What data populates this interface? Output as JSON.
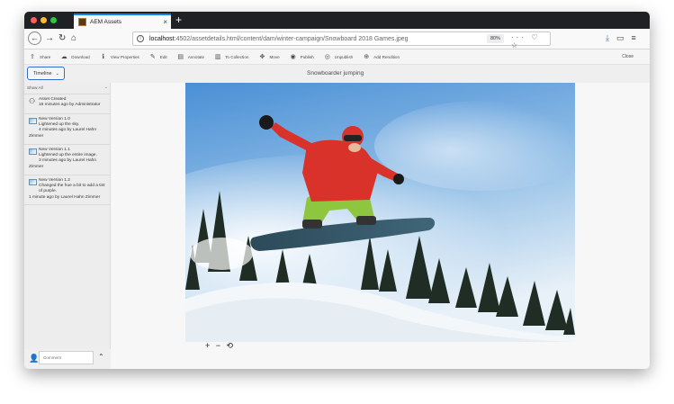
{
  "browser": {
    "traffic_light_colors": [
      "#ff5f57",
      "#febc2e",
      "#28c840"
    ],
    "tab": {
      "title": "AEM Assets",
      "close_glyph": "×"
    },
    "new_tab_glyph": "+",
    "url_host": "localhost",
    "url_path": ":4502/assetdetails.html/content/dam/winter-campaign/Snowboard 2018 Games.jpeg",
    "zoom": "80%",
    "url_icons": "··· ♡ ☆",
    "accent": "#0a84ff"
  },
  "toolbar": {
    "actions": [
      {
        "icon": "share-icon",
        "glyph": "⇪",
        "label": "Share"
      },
      {
        "icon": "download-icon",
        "glyph": "☁",
        "label": "Download"
      },
      {
        "icon": "info-icon",
        "glyph": "ℹ",
        "label": "View Properties"
      },
      {
        "icon": "edit-icon",
        "glyph": "✎",
        "label": "Edit"
      },
      {
        "icon": "annotate-icon",
        "glyph": "▤",
        "label": "Annotate"
      },
      {
        "icon": "collection-icon",
        "glyph": "▥",
        "label": "To Collection"
      },
      {
        "icon": "move-icon",
        "glyph": "✥",
        "label": "Move"
      },
      {
        "icon": "publish-icon",
        "glyph": "◉",
        "label": "Publish"
      },
      {
        "icon": "unpublish-icon",
        "glyph": "◎",
        "label": "Unpublish"
      },
      {
        "icon": "add-rendition-icon",
        "glyph": "⊕",
        "label": "Add Rendition"
      }
    ],
    "close_label": "Close"
  },
  "subbar": {
    "timeline_label": "Timeline",
    "title": "Snowboarder jumping"
  },
  "rail": {
    "filter_label": "Show All",
    "entries": [
      {
        "type": "user",
        "line1": "Asset Created",
        "line2": "16 minutes ago by Administrator",
        "line3": "",
        "tail": ""
      },
      {
        "type": "version",
        "line1": "New Version 1.0",
        "line2": "Lightened up the sky.",
        "line3": "4 minutes ago by Laurel Hahn",
        "tail": "Zimmer"
      },
      {
        "type": "version",
        "line1": "New Version 1.1",
        "line2": "Lightened up the entire image.",
        "line3": "3 minutes ago by Laurel Hahn",
        "tail": "Zimmer"
      },
      {
        "type": "version",
        "line1": "New Version 1.2",
        "line2": "Changed the hue a bit to add a tint",
        "line3": "of purple.",
        "tail": "1 minute ago by Laurel Hahn Zimmer"
      }
    ],
    "comment_placeholder": "Comment"
  },
  "viewer": {
    "zoom_controls": "+ − ⟲"
  }
}
